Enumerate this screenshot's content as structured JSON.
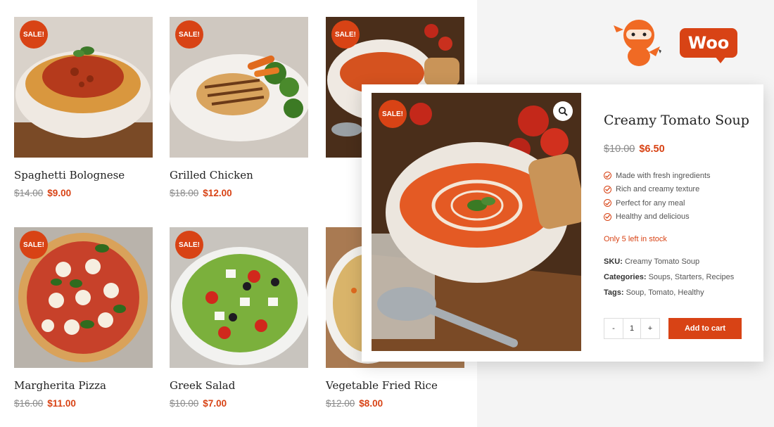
{
  "colors": {
    "accent": "#d84315",
    "strike": "#8a8a8a"
  },
  "badge": "SALE!",
  "products": [
    {
      "name": "Spaghetti Bolognese",
      "old_price": "$14.00",
      "new_price": "$9.00"
    },
    {
      "name": "Grilled Chicken",
      "old_price": "$18.00",
      "new_price": "$12.00"
    },
    {
      "name": "Margherita Pizza",
      "old_price": "$16.00",
      "new_price": "$11.00"
    },
    {
      "name": "Greek Salad",
      "old_price": "$10.00",
      "new_price": "$7.00"
    },
    {
      "name": "Vegetable Fried Rice",
      "old_price": "$12.00",
      "new_price": "$8.00"
    }
  ],
  "detail": {
    "title": "Creamy Tomato Soup",
    "old_price": "$10.00",
    "new_price": "$6.50",
    "features": [
      "Made with fresh ingredients",
      "Rich and creamy texture",
      "Perfect for any meal",
      "Healthy and delicious"
    ],
    "stock": "Only 5 left in stock",
    "sku_label": "SKU:",
    "sku": "Creamy Tomato Soup",
    "categories_label": "Categories:",
    "categories": "Soups, Starters, Recipes",
    "tags_label": "Tags:",
    "tags": "Soup, Tomato, Healthy",
    "qty_minus": "-",
    "qty": "1",
    "qty_plus": "+",
    "add_to_cart": "Add to cart"
  },
  "logo": {
    "woo_text": "Woo"
  },
  "icons": {
    "zoom": "magnifier-icon",
    "check": "check-circle-icon",
    "mascot": "ninja-mascot-icon"
  }
}
